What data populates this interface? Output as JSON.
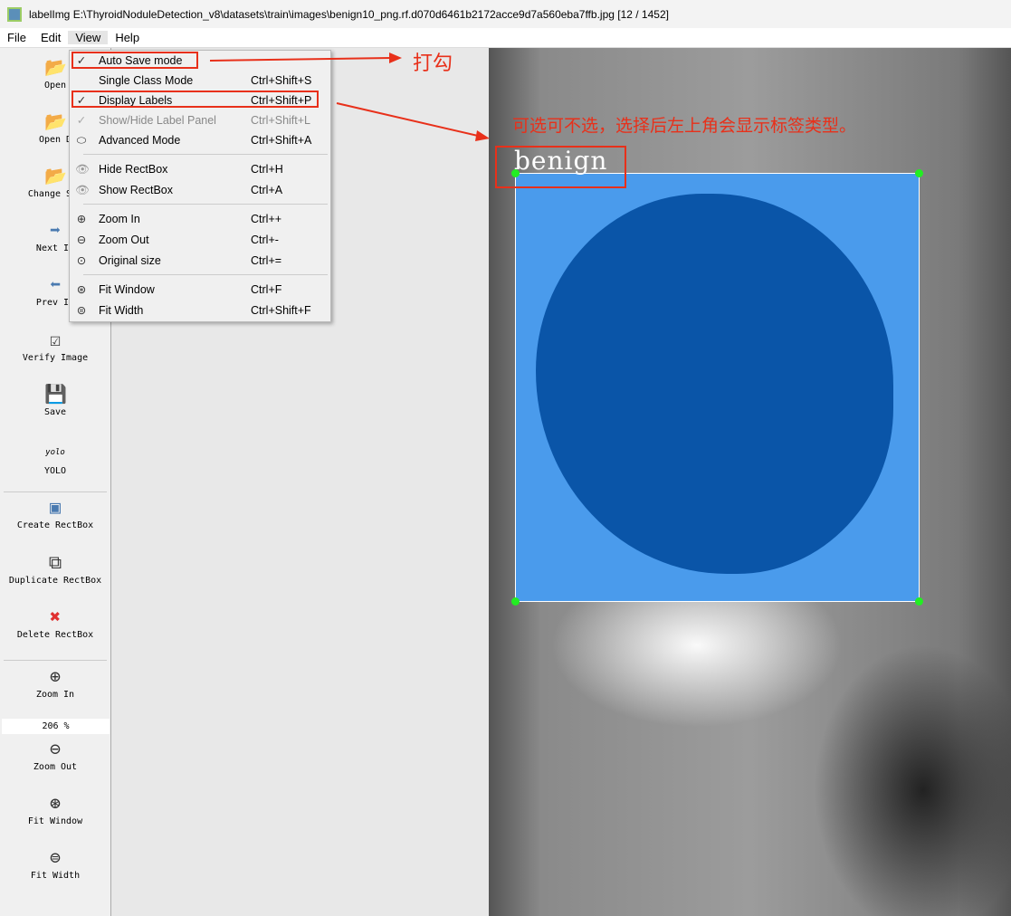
{
  "window": {
    "title": "labelImg E:\\ThyroidNoduleDetection_v8\\datasets\\train\\images\\benign10_png.rf.d070d6461b2172acce9d7a560eba7ffb.jpg [12 / 1452]"
  },
  "menubar": [
    "File",
    "Edit",
    "View",
    "Help"
  ],
  "toolbar": {
    "open": "Open",
    "open_dir": "Open D",
    "change_save": "Change Sav",
    "next": "Next Im",
    "prev": "Prev Im",
    "verify": "Verify Image",
    "save": "Save",
    "yolo_icon": "yolo",
    "yolo": "YOLO",
    "create": "Create RectBox",
    "duplicate": "Duplicate RectBox",
    "delete": "Delete RectBox",
    "zoom_in": "Zoom In",
    "zoom_value": "206 %",
    "zoom_out": "Zoom Out",
    "fit_window": "Fit Window",
    "fit_width": "Fit Width"
  },
  "view_menu": [
    {
      "label": "Auto Save mode",
      "shortcut": "",
      "checked": true
    },
    {
      "label": "Single Class Mode",
      "shortcut": "Ctrl+Shift+S"
    },
    {
      "label": "Display Labels",
      "shortcut": "Ctrl+Shift+P",
      "checked": true
    },
    {
      "label": "Show/Hide Label Panel",
      "shortcut": "Ctrl+Shift+L",
      "disabled": true
    },
    {
      "label": "Advanced Mode",
      "shortcut": "Ctrl+Shift+A"
    },
    {
      "label": "Hide RectBox",
      "shortcut": "Ctrl+H"
    },
    {
      "label": "Show RectBox",
      "shortcut": "Ctrl+A"
    },
    {
      "label": "Zoom In",
      "shortcut": "Ctrl++"
    },
    {
      "label": "Zoom Out",
      "shortcut": "Ctrl+-"
    },
    {
      "label": "Original size",
      "shortcut": "Ctrl+="
    },
    {
      "label": "Fit Window",
      "shortcut": "Ctrl+F"
    },
    {
      "label": "Fit Width",
      "shortcut": "Ctrl+Shift+F"
    }
  ],
  "canvas": {
    "box_label": "benign"
  },
  "annotations": {
    "check": "打勾",
    "note": "可选可不选，选择后左上角会显示标签类型。"
  }
}
